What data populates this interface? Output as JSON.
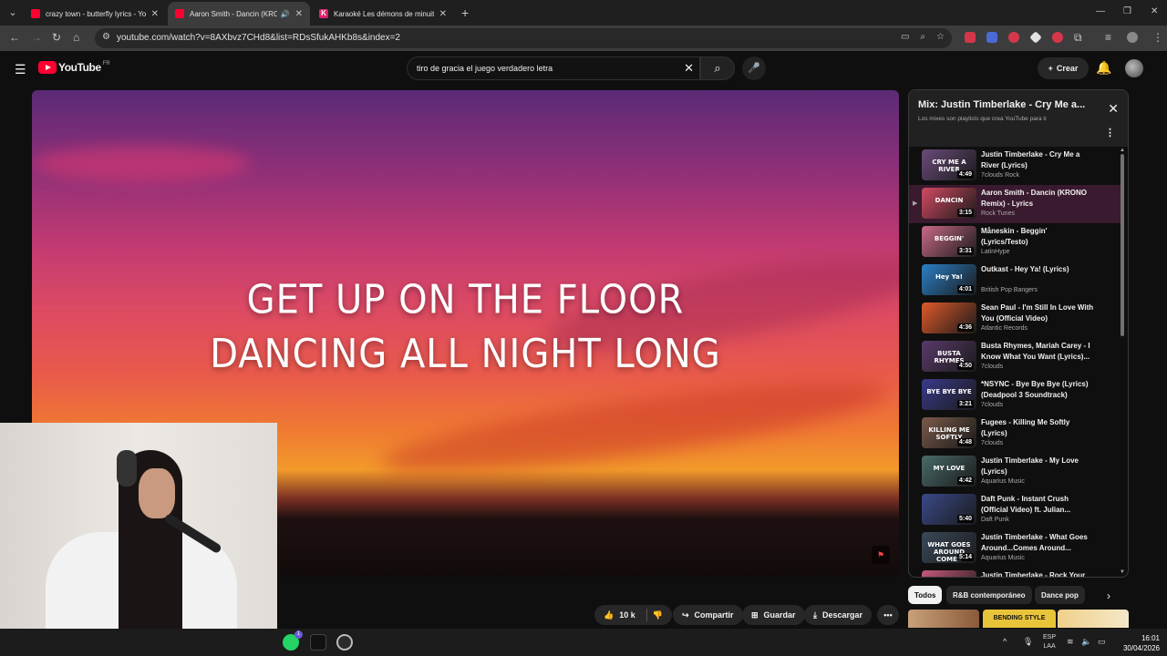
{
  "browser": {
    "tabs": [
      {
        "title": "crazy town - butterfly lyrics - Yo",
        "favicon": "youtube-icon",
        "active": false
      },
      {
        "title": "Aaron Smith - Dancin (KRON",
        "favicon": "youtube-icon",
        "active": true,
        "audio": true
      },
      {
        "title": "Karaoké Les démons de minuit",
        "favicon": "k-icon",
        "active": false
      }
    ],
    "new_tab_glyph": "+",
    "url": "youtube.com/watch?v=8AXbvz7CHd8&list=RDsSfukAHKb8s&index=2"
  },
  "youtube": {
    "logo_text": "YouTube",
    "country_code": "FR",
    "search_query": "tiro de gracia el juego verdadero letra",
    "create_label": "Crear"
  },
  "video": {
    "lyrics_line1": "GET UP ON THE FLOOR",
    "lyrics_line2": "DANCING ALL NIGHT LONG"
  },
  "actions": {
    "likes": "10 k",
    "share": "Compartir",
    "save": "Guardar",
    "download": "Descargar"
  },
  "playlist": {
    "title": "Mix: Justin Timberlake - Cry Me a...",
    "subtitle": "Los mixes son playlists que crea YouTube para ti",
    "items": [
      {
        "title": "Justin Timberlake - Cry Me a River (Lyrics)",
        "channel": "7clouds Rock",
        "duration": "4:49",
        "thumb_text": "CRY ME A RIVER",
        "color": "#6a4b7a",
        "current": false
      },
      {
        "title": "Aaron Smith - Dancin (KRONO Remix) - Lyrics",
        "channel": "Rock Tunes",
        "duration": "3:15",
        "thumb_text": "DANCIN",
        "color": "#d24a62",
        "current": true
      },
      {
        "title": "Måneskin - Beggin' (Lyrics/Testo)",
        "channel": "LatinHype",
        "duration": "3:31",
        "thumb_text": "BEGGIN'",
        "color": "#c86a86",
        "current": false
      },
      {
        "title": "Outkast - Hey Ya! (Lyrics)",
        "channel": "British Pop Bangers",
        "duration": "4:01",
        "thumb_text": "Hey Ya!",
        "color": "#2a7fc6",
        "current": false
      },
      {
        "title": "Sean Paul - I'm Still In Love With You (Official Video)",
        "channel": "Atlantic Records",
        "duration": "4:36",
        "thumb_text": "",
        "color": "#e05a2a",
        "current": false
      },
      {
        "title": "Busta Rhymes, Mariah Carey - I Know What You Want (Lyrics)...",
        "channel": "7clouds",
        "duration": "4:50",
        "thumb_text": "BUSTA RHYMES",
        "color": "#5a3a6a",
        "current": false
      },
      {
        "title": "*NSYNC - Bye Bye Bye (Lyrics) (Deadpool 3 Soundtrack)",
        "channel": "7clouds",
        "duration": "3:21",
        "thumb_text": "BYE BYE BYE",
        "color": "#3a3a8a",
        "current": false
      },
      {
        "title": "Fugees - Killing Me Softly (Lyrics)",
        "channel": "7clouds",
        "duration": "4:48",
        "thumb_text": "KILLING ME SOFTLY",
        "color": "#7a5a4a",
        "current": false
      },
      {
        "title": "Justin Timberlake - My Love (Lyrics)",
        "channel": "Aquarius Music",
        "duration": "4:42",
        "thumb_text": "MY LOVE",
        "color": "#4a6a6a",
        "current": false
      },
      {
        "title": "Daft Punk - Instant Crush (Official Video) ft. Julian...",
        "channel": "Daft Punk",
        "duration": "5:40",
        "thumb_text": "",
        "color": "#3a4a8a",
        "current": false
      },
      {
        "title": "Justin Timberlake - What Goes Around...Comes Around...",
        "channel": "Aquarius Music",
        "duration": "5:14",
        "thumb_text": "WHAT GOES AROUND COMES AROUND",
        "color": "#3a4a5a",
        "current": false
      },
      {
        "title": "Justin Timberlake - Rock Your",
        "channel": "",
        "duration": "",
        "thumb_text": "",
        "color": "#c85a7a",
        "current": false
      }
    ]
  },
  "chips": [
    "Todos",
    "R&B contemporáneo",
    "Dance pop"
  ],
  "recommendations": {
    "thumb_text": "BENDING STYLE"
  },
  "taskbar": {
    "language": "ESP",
    "layout": "LAA",
    "time": "16:01",
    "date": "30/04/2026",
    "whatsapp_badge": "1"
  }
}
